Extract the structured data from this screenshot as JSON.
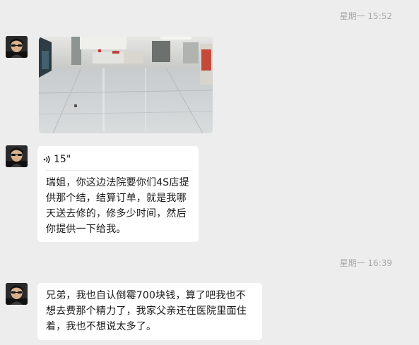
{
  "messages": [
    {
      "timestamp": "星期一 15:52",
      "type": "image"
    },
    {
      "type": "voice",
      "duration": "15\"",
      "transcript": "瑞姐，你这边法院要你们4S店提供那个结，结算订单，就是我哪天送去修的，修多少时间，然后你提供一下给我。"
    },
    {
      "timestamp": "星期一 16:39",
      "type": "text",
      "text": "兄弟，我也自认倒霉700块钱，算了吧我也不想去费那个精力了，我家父亲还在医院里面住着，我也不想说太多了。"
    }
  ],
  "icons": {
    "voice": "voice-wave-icon",
    "avatar": "avatar-image"
  },
  "colors": {
    "background": "#ededed",
    "bubble": "#ffffff",
    "timestamp": "#a9a9a9"
  }
}
